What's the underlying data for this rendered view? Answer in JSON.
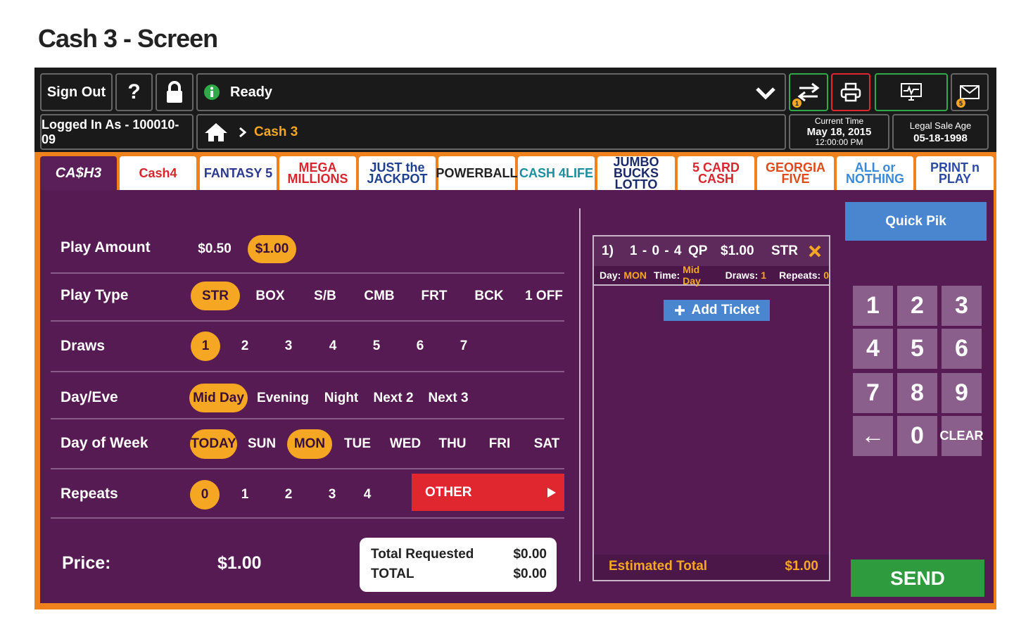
{
  "page_title": "Cash 3 - Screen",
  "topbar": {
    "sign_out": "Sign Out",
    "help": "?",
    "status": "Ready",
    "logged_in": "Logged In As - 100010-09",
    "breadcrumb_current": "Cash 3",
    "transfer_badge": "1",
    "mail_badge": "5",
    "current_time_label": "Current Time",
    "current_date": "May 18, 2015",
    "current_time": "12:00:00 PM",
    "legal_age_label": "Legal Sale Age",
    "legal_age_date": "05-18-1998"
  },
  "game_tabs": [
    {
      "name": "CA$H3",
      "color": "#ffffff"
    },
    {
      "name": "Cash4",
      "color": "#d8262f"
    },
    {
      "name": "FANTASY 5",
      "color": "#2b3a8f"
    },
    {
      "name": "MEGA MILLIONS",
      "color": "#d8262f"
    },
    {
      "name": "JUST the JACKPOT",
      "color": "#1f3f8f"
    },
    {
      "name": "POWERBALL",
      "color": "#222222"
    },
    {
      "name": "CASH 4LIFE",
      "color": "#1a8fa0"
    },
    {
      "name": "JUMBO BUCKS LOTTO",
      "color": "#1a2a6a"
    },
    {
      "name": "5 CARD CASH",
      "color": "#d8262f"
    },
    {
      "name": "GEORGIA FIVE",
      "color": "#e04a1a"
    },
    {
      "name": "ALL or NOTHING",
      "color": "#3a8ad8"
    },
    {
      "name": "PRINT n PLAY",
      "color": "#2b4aa8"
    }
  ],
  "play_amount": {
    "label": "Play Amount",
    "options": [
      "$0.50",
      "$1.00"
    ],
    "selected": "$1.00"
  },
  "play_type": {
    "label": "Play Type",
    "options": [
      "STR",
      "BOX",
      "S/B",
      "CMB",
      "FRT",
      "BCK",
      "1 OFF"
    ],
    "selected": "STR"
  },
  "draws": {
    "label": "Draws",
    "options": [
      "1",
      "2",
      "3",
      "4",
      "5",
      "6",
      "7"
    ],
    "selected": "1"
  },
  "day_eve": {
    "label": "Day/Eve",
    "options": [
      "Mid Day",
      "Evening",
      "Night",
      "Next 2",
      "Next 3"
    ],
    "selected": "Mid Day"
  },
  "day_of_week": {
    "label": "Day of Week",
    "options": [
      "TODAY",
      "SUN",
      "MON",
      "TUE",
      "WED",
      "THU",
      "FRI",
      "SAT"
    ],
    "selected": [
      "TODAY",
      "MON"
    ]
  },
  "repeats": {
    "label": "Repeats",
    "options": [
      "0",
      "1",
      "2",
      "3",
      "4"
    ],
    "selected": "0",
    "other": "OTHER"
  },
  "price": {
    "label": "Price:",
    "value": "$1.00"
  },
  "totals": {
    "requested_label": "Total Requested",
    "requested_value": "$0.00",
    "total_label": "TOTAL",
    "total_value": "$0.00"
  },
  "ticket": {
    "index": "1)",
    "numbers": "1 - 0 - 4",
    "qp": "QP",
    "amount": "$1.00",
    "type": "STR",
    "day_label": "Day:",
    "day_value": "MON",
    "time_label": "Time:",
    "time_value": "Mid Day",
    "draws_label": "Draws:",
    "draws_value": "1",
    "repeats_label": "Repeats:",
    "repeats_value": "0",
    "add_ticket": "Add Ticket",
    "estimated_label": "Estimated Total",
    "estimated_value": "$1.00"
  },
  "keypad": {
    "quick_pik": "Quick Pik",
    "keys": [
      "1",
      "2",
      "3",
      "4",
      "5",
      "6",
      "7",
      "8",
      "9",
      "←",
      "0",
      "CLEAR"
    ],
    "send": "SEND"
  }
}
